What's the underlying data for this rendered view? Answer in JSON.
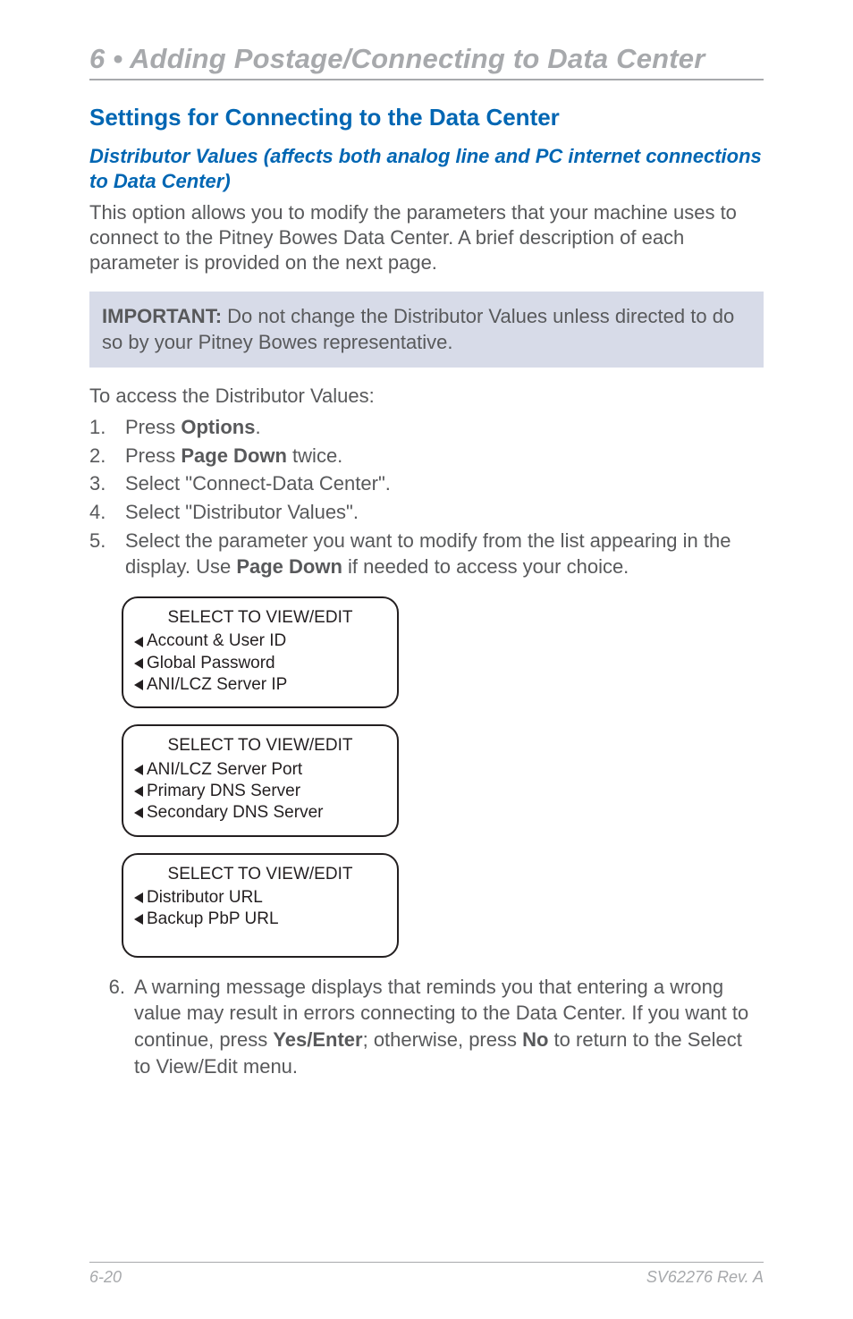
{
  "chapter": {
    "title": "6 • Adding Postage/Connecting to Data Center"
  },
  "section": {
    "heading": "Settings for Connecting to the Data Center",
    "sub_heading": "Distributor Values (affects both analog line and PC internet connections to Data Center)",
    "intro": "This option allows you to modify the parameters that your machine uses to connect to the Pitney Bowes Data Center. A brief description of each parameter is provided on the next page."
  },
  "important": {
    "label": "IMPORTANT:",
    "text": " Do not change the Distributor Values unless directed to do so by your Pitney Bowes representative."
  },
  "access_line": "To access the Distributor Values:",
  "steps": [
    {
      "num": "1.",
      "pre": "Press ",
      "bold": "Options",
      "post": "."
    },
    {
      "num": "2.",
      "pre": "Press ",
      "bold": "Page Down",
      "post": " twice."
    },
    {
      "num": "3.",
      "pre": "Select \"Connect-Data Center\".",
      "bold": "",
      "post": ""
    },
    {
      "num": "4.",
      "pre": "Select \"Distributor Values\".",
      "bold": "",
      "post": ""
    }
  ],
  "step5": {
    "num": "5.",
    "pre": "Select the parameter you want to modify from the list appearing in the display. Use ",
    "bold": "Page Down",
    "post": " if needed to access your choice."
  },
  "displays": [
    {
      "title": "SELECT TO VIEW/EDIT",
      "lines": [
        "Account & User ID",
        "Global Password",
        "ANI/LCZ Server IP"
      ]
    },
    {
      "title": "SELECT TO VIEW/EDIT",
      "lines": [
        "ANI/LCZ Server Port",
        "Primary DNS Server",
        "Secondary DNS Server"
      ]
    },
    {
      "title": "SELECT TO VIEW/EDIT",
      "lines": [
        "Distributor URL",
        "Backup PbP URL"
      ]
    }
  ],
  "step6": {
    "num": "6.",
    "pre": "A warning message displays that reminds you that entering a wrong value may result in errors connecting to the Data Center. If you want to continue, press ",
    "bold1": "Yes/Enter",
    "mid": "; otherwise, press ",
    "bold2": "No",
    "post": " to return to the Select to View/Edit menu."
  },
  "footer": {
    "left": "6-20",
    "right": "SV62276 Rev. A"
  }
}
